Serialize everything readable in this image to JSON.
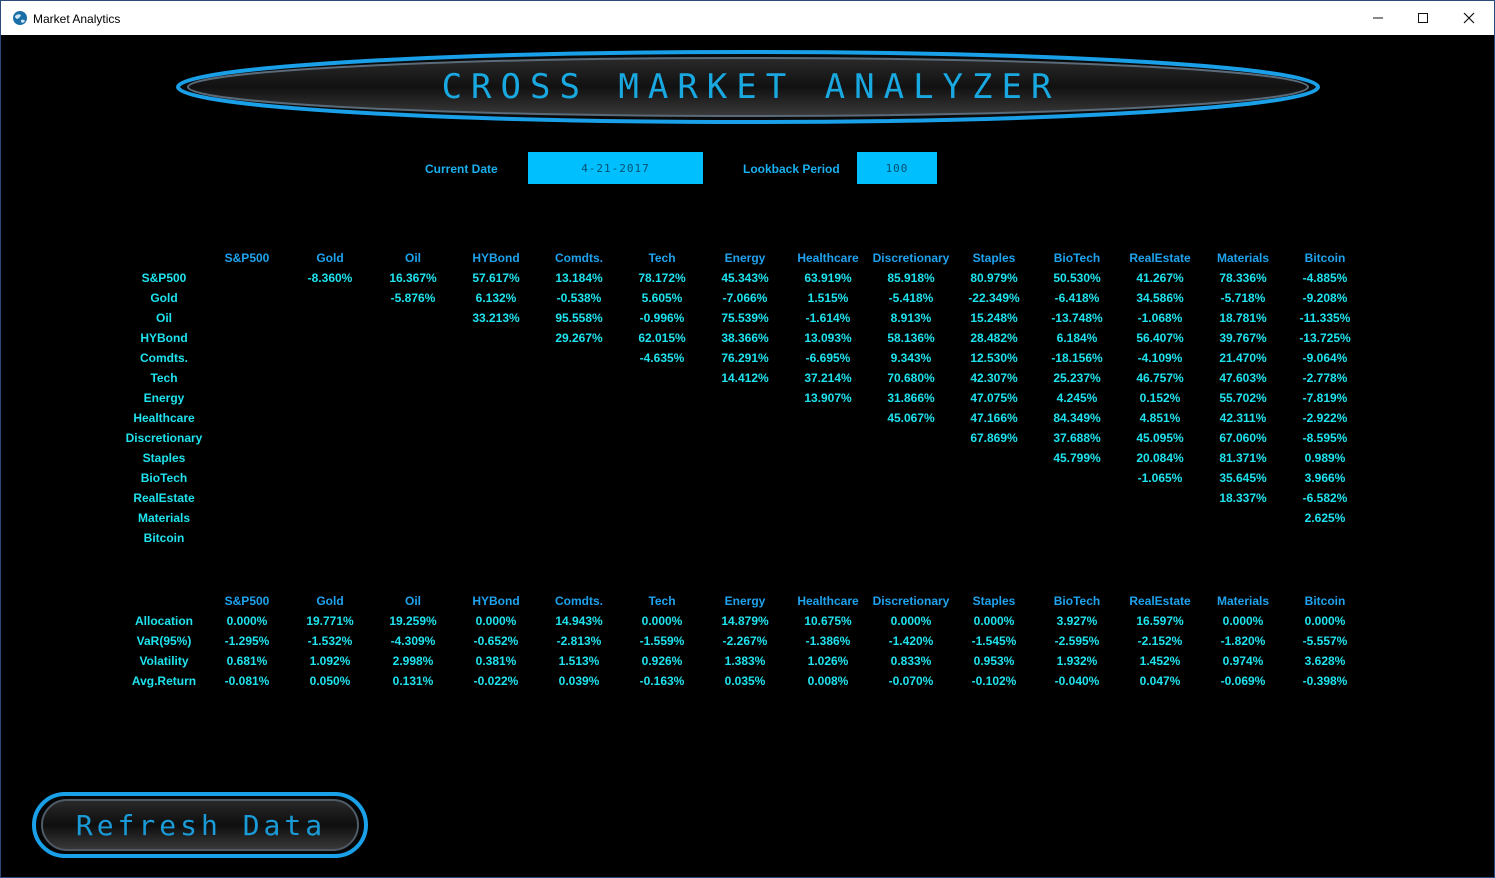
{
  "window": {
    "title": "Market Analytics",
    "icon": "globe-icon",
    "controls": {
      "minimize": "minimize-icon",
      "maximize": "maximize-icon",
      "close": "close-icon"
    }
  },
  "header": {
    "title": "CROSS MARKET ANALYZER"
  },
  "form": {
    "date_label": "Current Date",
    "date_value": "4-21-2017",
    "lookback_label": "Lookback Period",
    "lookback_value": "100"
  },
  "assets": [
    "S&P500",
    "Gold",
    "Oil",
    "HYBond",
    "Comdts.",
    "Tech",
    "Energy",
    "Healthcare",
    "Discretionary",
    "Staples",
    "BioTech",
    "RealEstate",
    "Materials",
    "Bitcoin"
  ],
  "correlation_table": {
    "rows": [
      [
        "",
        "-8.360%",
        "16.367%",
        "57.617%",
        "13.184%",
        "78.172%",
        "45.343%",
        "63.919%",
        "85.918%",
        "80.979%",
        "50.530%",
        "41.267%",
        "78.336%",
        "-4.885%"
      ],
      [
        "",
        "",
        "-5.876%",
        "6.132%",
        "-0.538%",
        "5.605%",
        "-7.066%",
        "1.515%",
        "-5.418%",
        "-22.349%",
        "-6.418%",
        "34.586%",
        "-5.718%",
        "-9.208%"
      ],
      [
        "",
        "",
        "",
        "33.213%",
        "95.558%",
        "-0.996%",
        "75.539%",
        "-1.614%",
        "8.913%",
        "15.248%",
        "-13.748%",
        "-1.068%",
        "18.781%",
        "-11.335%"
      ],
      [
        "",
        "",
        "",
        "",
        "29.267%",
        "62.015%",
        "38.366%",
        "13.093%",
        "58.136%",
        "28.482%",
        "6.184%",
        "56.407%",
        "39.767%",
        "-13.725%"
      ],
      [
        "",
        "",
        "",
        "",
        "",
        "-4.635%",
        "76.291%",
        "-6.695%",
        "9.343%",
        "12.530%",
        "-18.156%",
        "-4.109%",
        "21.470%",
        "-9.064%"
      ],
      [
        "",
        "",
        "",
        "",
        "",
        "",
        "14.412%",
        "37.214%",
        "70.680%",
        "42.307%",
        "25.237%",
        "46.757%",
        "47.603%",
        "-2.778%"
      ],
      [
        "",
        "",
        "",
        "",
        "",
        "",
        "",
        "13.907%",
        "31.866%",
        "47.075%",
        "4.245%",
        "0.152%",
        "55.702%",
        "-7.819%"
      ],
      [
        "",
        "",
        "",
        "",
        "",
        "",
        "",
        "",
        "45.067%",
        "47.166%",
        "84.349%",
        "4.851%",
        "42.311%",
        "-2.922%"
      ],
      [
        "",
        "",
        "",
        "",
        "",
        "",
        "",
        "",
        "",
        "67.869%",
        "37.688%",
        "45.095%",
        "67.060%",
        "-8.595%"
      ],
      [
        "",
        "",
        "",
        "",
        "",
        "",
        "",
        "",
        "",
        "",
        "45.799%",
        "20.084%",
        "81.371%",
        "0.989%"
      ],
      [
        "",
        "",
        "",
        "",
        "",
        "",
        "",
        "",
        "",
        "",
        "",
        "-1.065%",
        "35.645%",
        "3.966%"
      ],
      [
        "",
        "",
        "",
        "",
        "",
        "",
        "",
        "",
        "",
        "",
        "",
        "",
        "18.337%",
        "-6.582%"
      ],
      [
        "",
        "",
        "",
        "",
        "",
        "",
        "",
        "",
        "",
        "",
        "",
        "",
        "",
        "2.625%"
      ],
      [
        "",
        "",
        "",
        "",
        "",
        "",
        "",
        "",
        "",
        "",
        "",
        "",
        "",
        ""
      ]
    ]
  },
  "stats_table": {
    "row_labels": [
      "Allocation",
      "VaR(95%)",
      "Volatility",
      "Avg.Return"
    ],
    "rows": [
      [
        "0.000%",
        "19.771%",
        "19.259%",
        "0.000%",
        "14.943%",
        "0.000%",
        "14.879%",
        "10.675%",
        "0.000%",
        "0.000%",
        "3.927%",
        "16.597%",
        "0.000%",
        "0.000%"
      ],
      [
        "-1.295%",
        "-1.532%",
        "-4.309%",
        "-0.652%",
        "-2.813%",
        "-1.559%",
        "-2.267%",
        "-1.386%",
        "-1.420%",
        "-1.545%",
        "-2.595%",
        "-2.152%",
        "-1.820%",
        "-5.557%"
      ],
      [
        "0.681%",
        "1.092%",
        "2.998%",
        "0.381%",
        "1.513%",
        "0.926%",
        "1.383%",
        "1.026%",
        "0.833%",
        "0.953%",
        "1.932%",
        "1.452%",
        "0.974%",
        "3.628%"
      ],
      [
        "-0.081%",
        "0.050%",
        "0.131%",
        "-0.022%",
        "0.039%",
        "-0.163%",
        "0.035%",
        "0.008%",
        "-0.070%",
        "-0.102%",
        "-0.040%",
        "0.047%",
        "-0.069%",
        "-0.398%"
      ]
    ]
  },
  "refresh_button": {
    "label": "Refresh Data"
  },
  "colors": {
    "background": "#000000",
    "accent": "#1ab0f0",
    "table_text": "#1fe3ee",
    "input_bg": "#00bfff"
  }
}
